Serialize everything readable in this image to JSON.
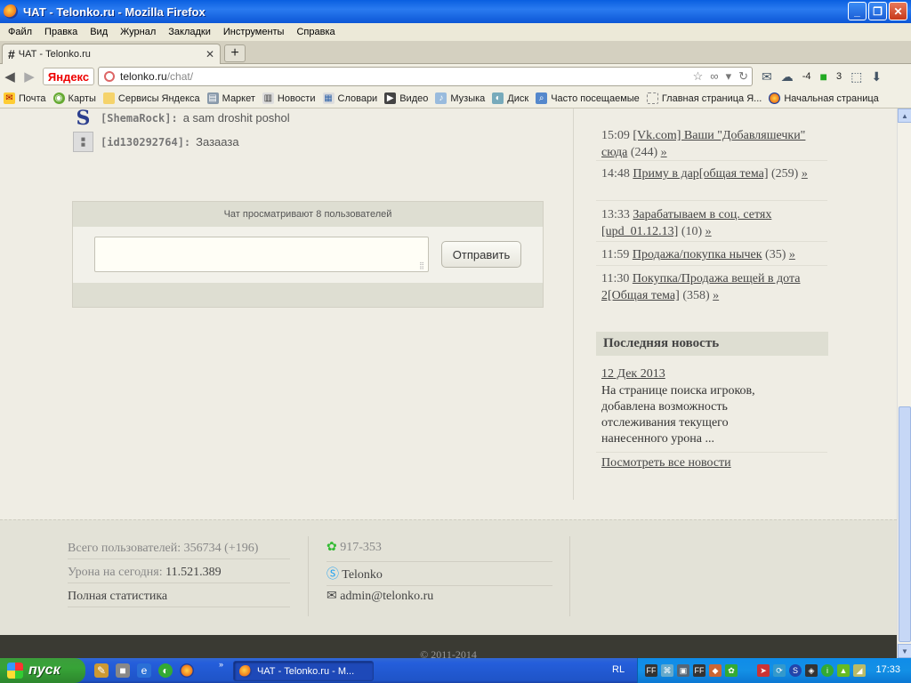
{
  "window": {
    "title": "ЧАТ - Telonko.ru - Mozilla Firefox"
  },
  "menu": [
    "Файл",
    "Правка",
    "Вид",
    "Журнал",
    "Закладки",
    "Инструменты",
    "Справка"
  ],
  "tab": {
    "title": "ЧАТ - Telonko.ru"
  },
  "nav": {
    "yandex_label": "Яндекс",
    "url_host": "telonko.ru",
    "url_path": "/chat/",
    "weather": "-4",
    "count": "3"
  },
  "bookmarks": [
    "Почта",
    "Карты",
    "Сервисы Яндекса",
    "Маркет",
    "Новости",
    "Словари",
    "Видео",
    "Музыка",
    "Диск",
    "Часто посещаемые",
    "Главная страница Я...",
    "Начальная страница"
  ],
  "chat": {
    "messages": [
      {
        "user": "[ShemaRock]:",
        "text": "a sam droshit poshol"
      },
      {
        "user": "[id130292764]:",
        "text": "Зазааза"
      }
    ],
    "viewers": "Чат просматривают 8 пользователей",
    "input_value": "",
    "send_label": "Отправить"
  },
  "sidebar": {
    "topics": [
      {
        "time": "15:09",
        "title": "[Vk.com] Ваши \"Добавляшечки\" сюда",
        "count": "(244)"
      },
      {
        "time": "14:48",
        "title": "Приму в дар[общая тема]",
        "count": "(259)"
      },
      {
        "time": "13:33",
        "title": "Зарабатываем в соц. сетях [upd_01.12.13]",
        "count": "(10)"
      },
      {
        "time": "11:59",
        "title": "Продажа/покупка нычек",
        "count": "(35)"
      },
      {
        "time": "11:30",
        "title": "Покупка/Продажа вещей в дота 2[Общая тема]",
        "count": "(358)"
      }
    ],
    "raquo": "»",
    "news_heading": "Последняя новость",
    "news_date": "12 Дек 2013",
    "news_text": "На странице поиска игроков, добавлена возможность отслеживания текущего нанесенного урона ...",
    "news_all": "Посмотреть все новости"
  },
  "footer": {
    "users_label": "Всего пользователей:",
    "users_value": "356734 (+196)",
    "damage_label": "Урона на сегодня:",
    "damage_value": "11.521.389",
    "stats_link": "Полная статистика",
    "icq": "917-353",
    "skype": "Telonko",
    "email": "admin@telonko.ru",
    "copyright": "© 2011-2014"
  },
  "taskbar": {
    "start_label": "пуск",
    "window_item": "ЧАТ - Telonko.ru - M...",
    "lang": "RL",
    "clock": "17:33"
  }
}
